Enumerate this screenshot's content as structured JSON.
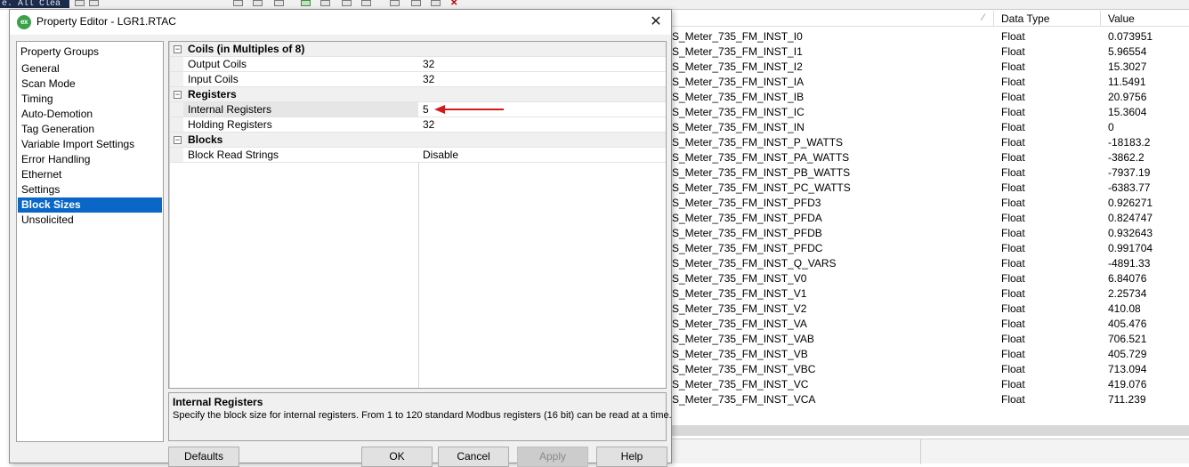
{
  "background": {
    "console_text": "e. All Clea",
    "columns": {
      "data_type": "Data Type",
      "value": "Value"
    },
    "rows": [
      {
        "name": "S_Meter_735_FM_INST_I0",
        "type": "Float",
        "value": "0.073951"
      },
      {
        "name": "S_Meter_735_FM_INST_I1",
        "type": "Float",
        "value": "5.96554"
      },
      {
        "name": "S_Meter_735_FM_INST_I2",
        "type": "Float",
        "value": "15.3027"
      },
      {
        "name": "S_Meter_735_FM_INST_IA",
        "type": "Float",
        "value": "11.5491"
      },
      {
        "name": "S_Meter_735_FM_INST_IB",
        "type": "Float",
        "value": "20.9756"
      },
      {
        "name": "S_Meter_735_FM_INST_IC",
        "type": "Float",
        "value": "15.3604"
      },
      {
        "name": "S_Meter_735_FM_INST_IN",
        "type": "Float",
        "value": "0"
      },
      {
        "name": "S_Meter_735_FM_INST_P_WATTS",
        "type": "Float",
        "value": "-18183.2"
      },
      {
        "name": "S_Meter_735_FM_INST_PA_WATTS",
        "type": "Float",
        "value": "-3862.2"
      },
      {
        "name": "S_Meter_735_FM_INST_PB_WATTS",
        "type": "Float",
        "value": "-7937.19"
      },
      {
        "name": "S_Meter_735_FM_INST_PC_WATTS",
        "type": "Float",
        "value": "-6383.77"
      },
      {
        "name": "S_Meter_735_FM_INST_PFD3",
        "type": "Float",
        "value": "0.926271"
      },
      {
        "name": "S_Meter_735_FM_INST_PFDA",
        "type": "Float",
        "value": "0.824747"
      },
      {
        "name": "S_Meter_735_FM_INST_PFDB",
        "type": "Float",
        "value": "0.932643"
      },
      {
        "name": "S_Meter_735_FM_INST_PFDC",
        "type": "Float",
        "value": "0.991704"
      },
      {
        "name": "S_Meter_735_FM_INST_Q_VARS",
        "type": "Float",
        "value": "-4891.33"
      },
      {
        "name": "S_Meter_735_FM_INST_V0",
        "type": "Float",
        "value": "6.84076"
      },
      {
        "name": "S_Meter_735_FM_INST_V1",
        "type": "Float",
        "value": "2.25734"
      },
      {
        "name": "S_Meter_735_FM_INST_V2",
        "type": "Float",
        "value": "410.08"
      },
      {
        "name": "S_Meter_735_FM_INST_VA",
        "type": "Float",
        "value": "405.476"
      },
      {
        "name": "S_Meter_735_FM_INST_VAB",
        "type": "Float",
        "value": "706.521"
      },
      {
        "name": "S_Meter_735_FM_INST_VB",
        "type": "Float",
        "value": "405.729"
      },
      {
        "name": "S_Meter_735_FM_INST_VBC",
        "type": "Float",
        "value": "713.094"
      },
      {
        "name": "S_Meter_735_FM_INST_VC",
        "type": "Float",
        "value": "419.076"
      },
      {
        "name": "S_Meter_735_FM_INST_VCA",
        "type": "Float",
        "value": "711.239"
      }
    ]
  },
  "dialog": {
    "app_icon_text": "ex",
    "title": "Property Editor - LGR1.RTAC",
    "close_glyph": "✕",
    "property_groups": {
      "title": "Property Groups",
      "items": [
        {
          "label": "General",
          "selected": false
        },
        {
          "label": "Scan Mode",
          "selected": false
        },
        {
          "label": "Timing",
          "selected": false
        },
        {
          "label": "Auto-Demotion",
          "selected": false
        },
        {
          "label": "Tag Generation",
          "selected": false
        },
        {
          "label": "Variable Import Settings",
          "selected": false
        },
        {
          "label": "Error Handling",
          "selected": false
        },
        {
          "label": "Ethernet",
          "selected": false
        },
        {
          "label": "Settings",
          "selected": false
        },
        {
          "label": "Block Sizes",
          "selected": true
        },
        {
          "label": "Unsolicited",
          "selected": false
        }
      ]
    },
    "categories": [
      {
        "label": "Coils (in Multiples of 8)",
        "toggle": "⊟",
        "properties": [
          {
            "name": "Output Coils",
            "value": "32"
          },
          {
            "name": "Input Coils",
            "value": "32"
          }
        ]
      },
      {
        "label": "Registers",
        "toggle": "⊟",
        "properties": [
          {
            "name": "Internal Registers",
            "value": "5"
          },
          {
            "name": "Holding Registers",
            "value": "32"
          }
        ]
      },
      {
        "label": "Blocks",
        "toggle": "⊟",
        "properties": [
          {
            "name": "Block Read Strings",
            "value": "Disable"
          }
        ]
      }
    ],
    "description": {
      "title": "Internal Registers",
      "text": "Specify the block size for internal registers. From 1 to 120 standard Modbus registers (16 bit) can be read at a time."
    },
    "buttons": {
      "defaults": "Defaults",
      "ok": "OK",
      "cancel": "Cancel",
      "apply": "Apply",
      "help": "Help"
    },
    "annotation_color": "#d01c1c",
    "selection_color": "#0a67c7"
  }
}
